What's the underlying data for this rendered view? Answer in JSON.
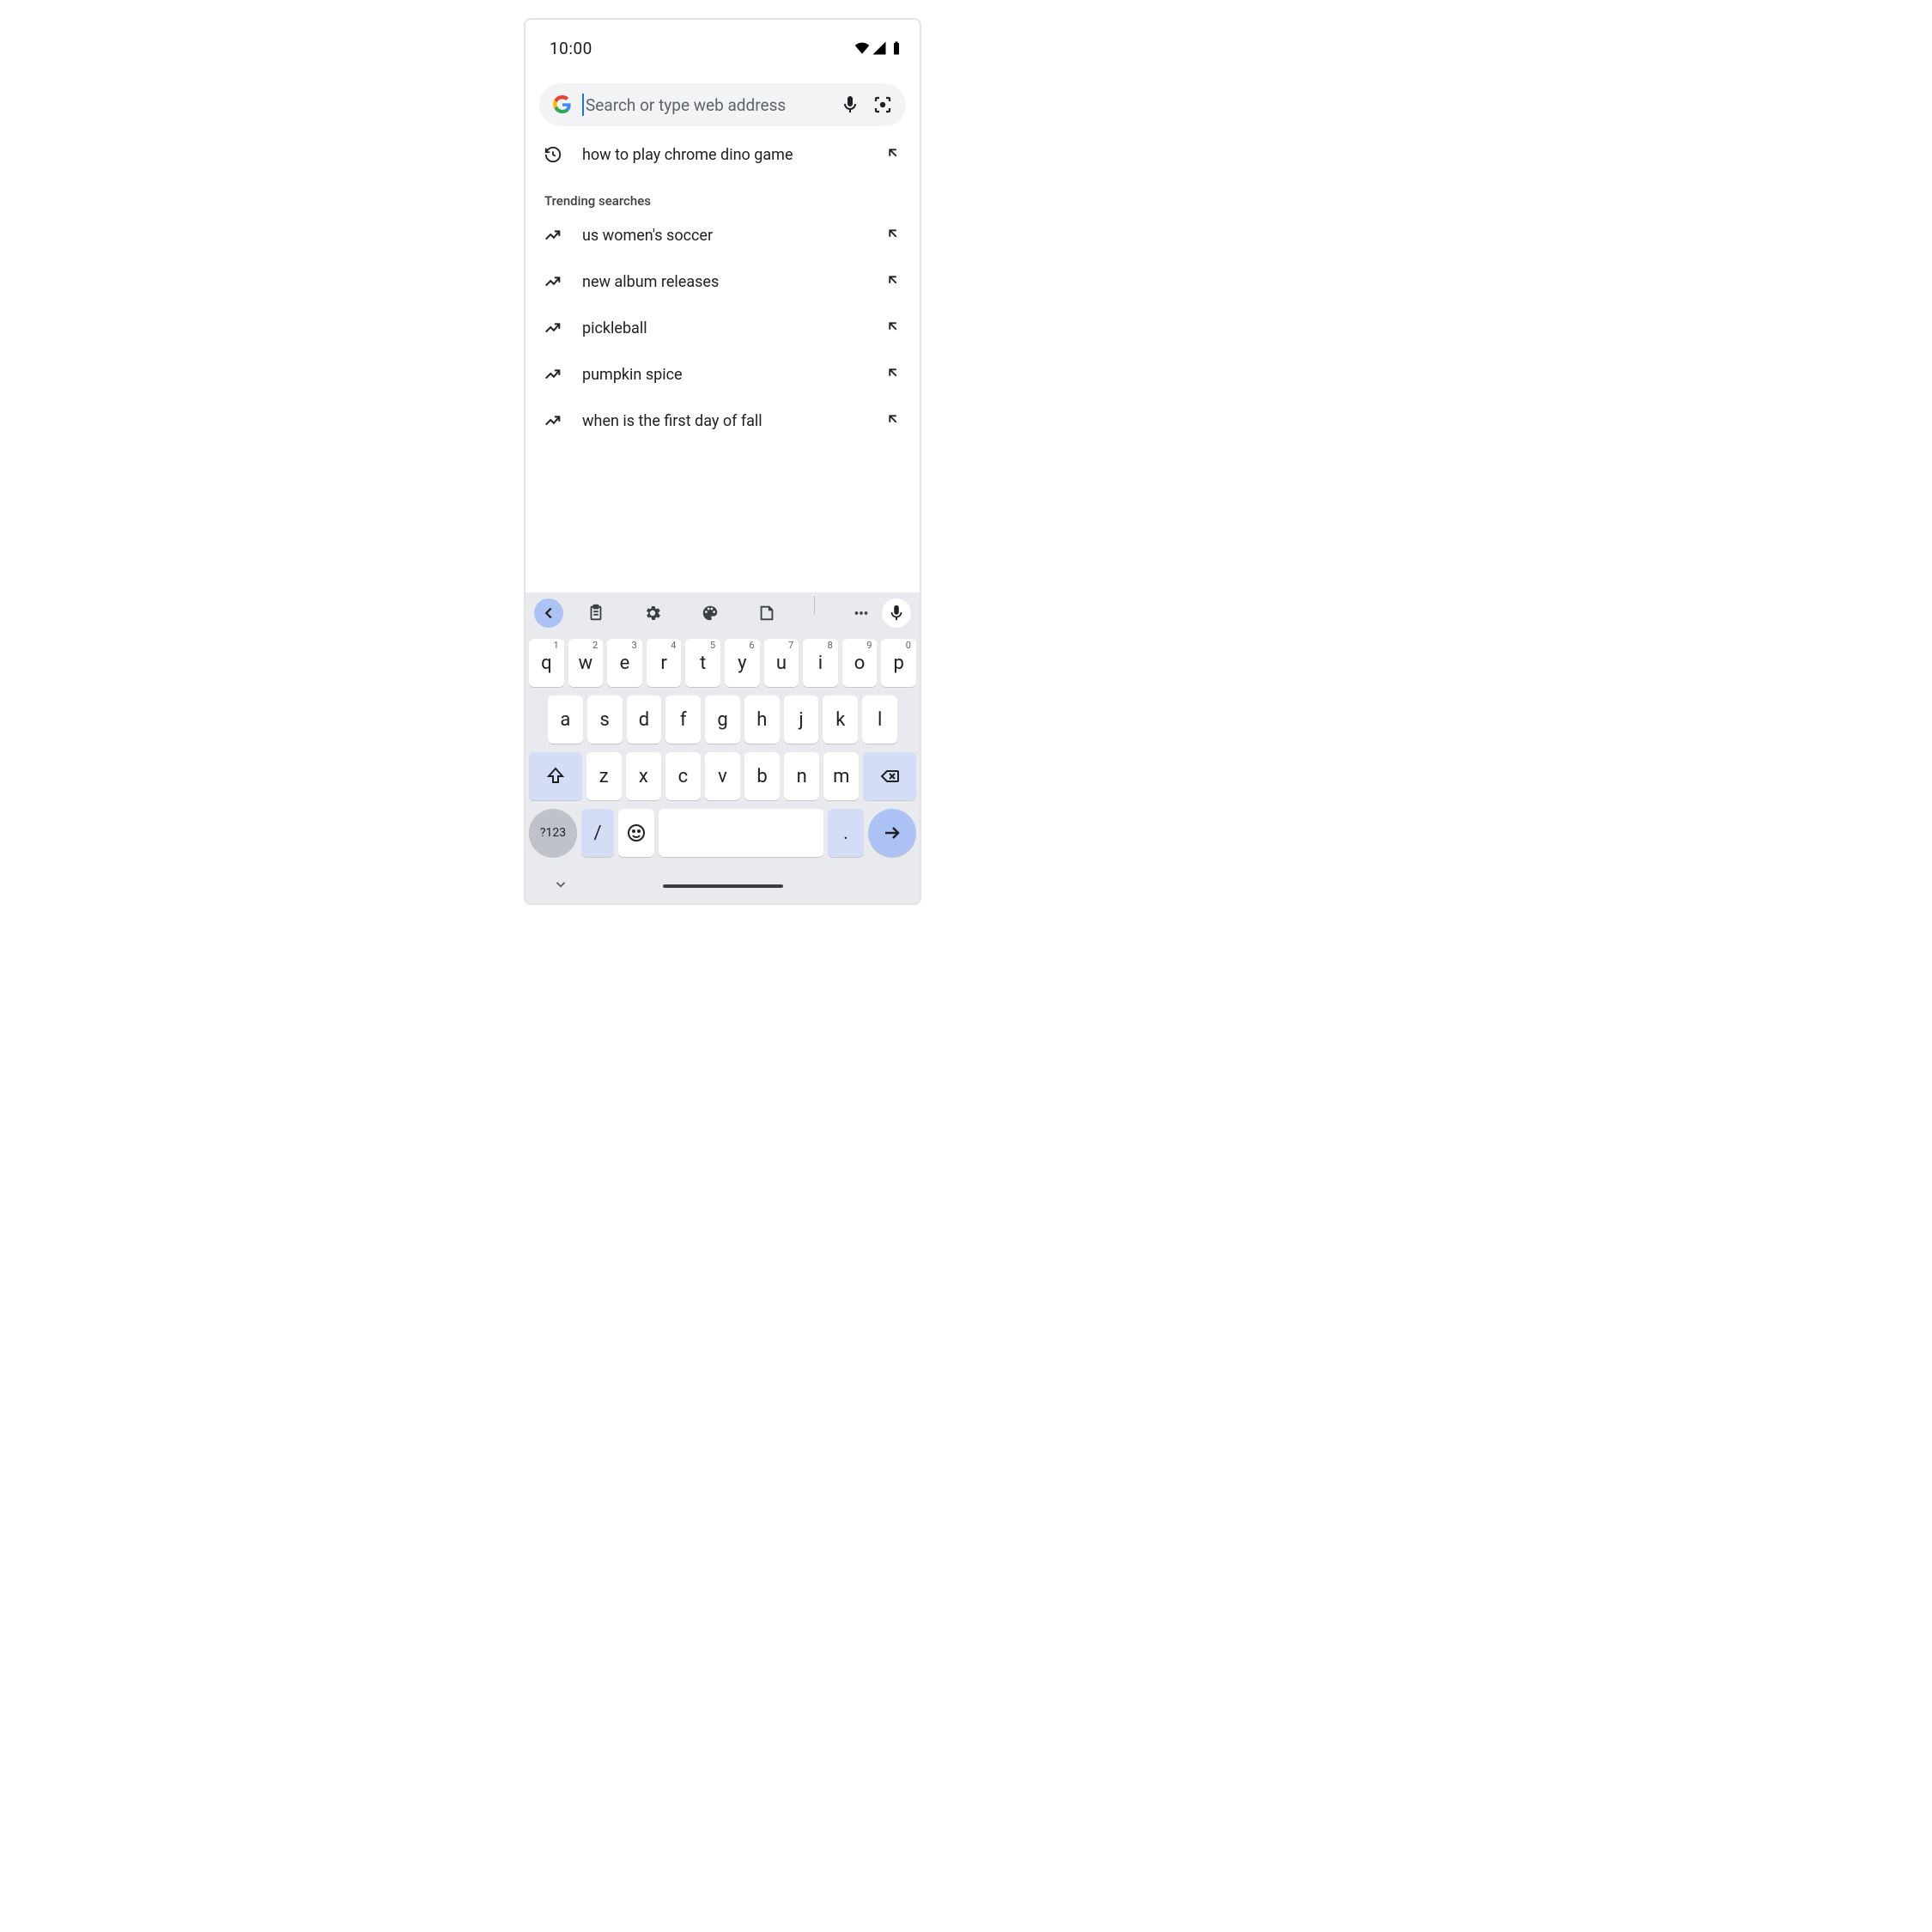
{
  "status": {
    "time": "10:00"
  },
  "search": {
    "placeholder": "Search or type web address"
  },
  "history": {
    "icon": "history",
    "text": "how to play chrome dino game"
  },
  "trending": {
    "title": "Trending searches",
    "items": [
      {
        "text": "us women's soccer"
      },
      {
        "text": "new album releases"
      },
      {
        "text": "pickleball"
      },
      {
        "text": "pumpkin spice"
      },
      {
        "text": "when is the first day of fall"
      }
    ]
  },
  "keyboard": {
    "row1": [
      {
        "k": "q",
        "h": "1"
      },
      {
        "k": "w",
        "h": "2"
      },
      {
        "k": "e",
        "h": "3"
      },
      {
        "k": "r",
        "h": "4"
      },
      {
        "k": "t",
        "h": "5"
      },
      {
        "k": "y",
        "h": "6"
      },
      {
        "k": "u",
        "h": "7"
      },
      {
        "k": "i",
        "h": "8"
      },
      {
        "k": "o",
        "h": "9"
      },
      {
        "k": "p",
        "h": "0"
      }
    ],
    "row2": [
      "a",
      "s",
      "d",
      "f",
      "g",
      "h",
      "j",
      "k",
      "l"
    ],
    "row3": [
      "z",
      "x",
      "c",
      "v",
      "b",
      "n",
      "m"
    ],
    "sym_label": "?123",
    "slash": "/",
    "period": "."
  }
}
